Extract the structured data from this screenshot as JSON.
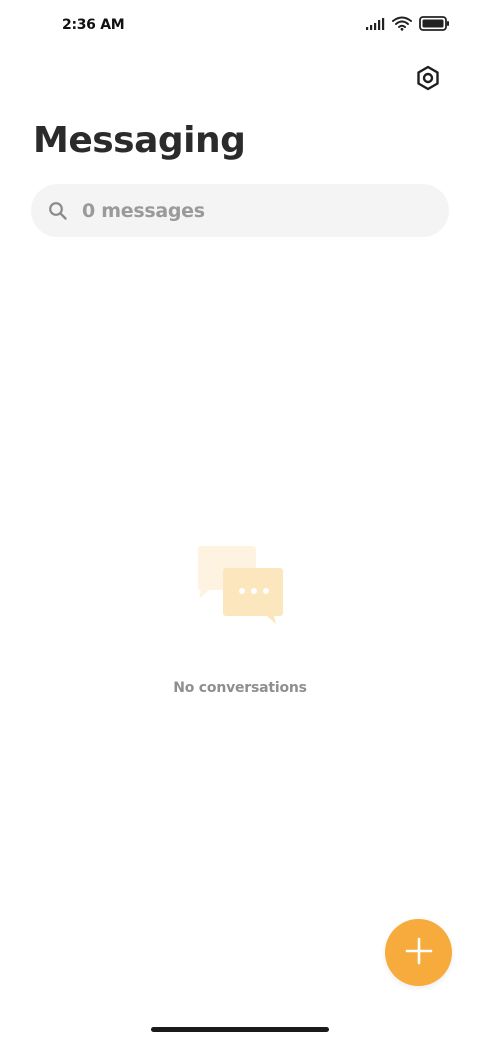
{
  "status_bar": {
    "time": "2:36 AM",
    "icons": [
      "signal-icon",
      "wifi-icon",
      "battery-icon"
    ]
  },
  "header": {
    "title": "Messaging",
    "settings_icon": "settings-icon"
  },
  "search": {
    "placeholder": "0 messages",
    "icon": "search-icon"
  },
  "empty_state": {
    "icon": "chat-bubbles-icon",
    "text": "No conversations"
  },
  "fab": {
    "icon": "plus-icon"
  },
  "colors": {
    "accent": "#f6ab3c",
    "search_bg": "#f4f4f4",
    "illustration_light": "#fdf3e0",
    "illustration_main": "#fce6bd"
  }
}
